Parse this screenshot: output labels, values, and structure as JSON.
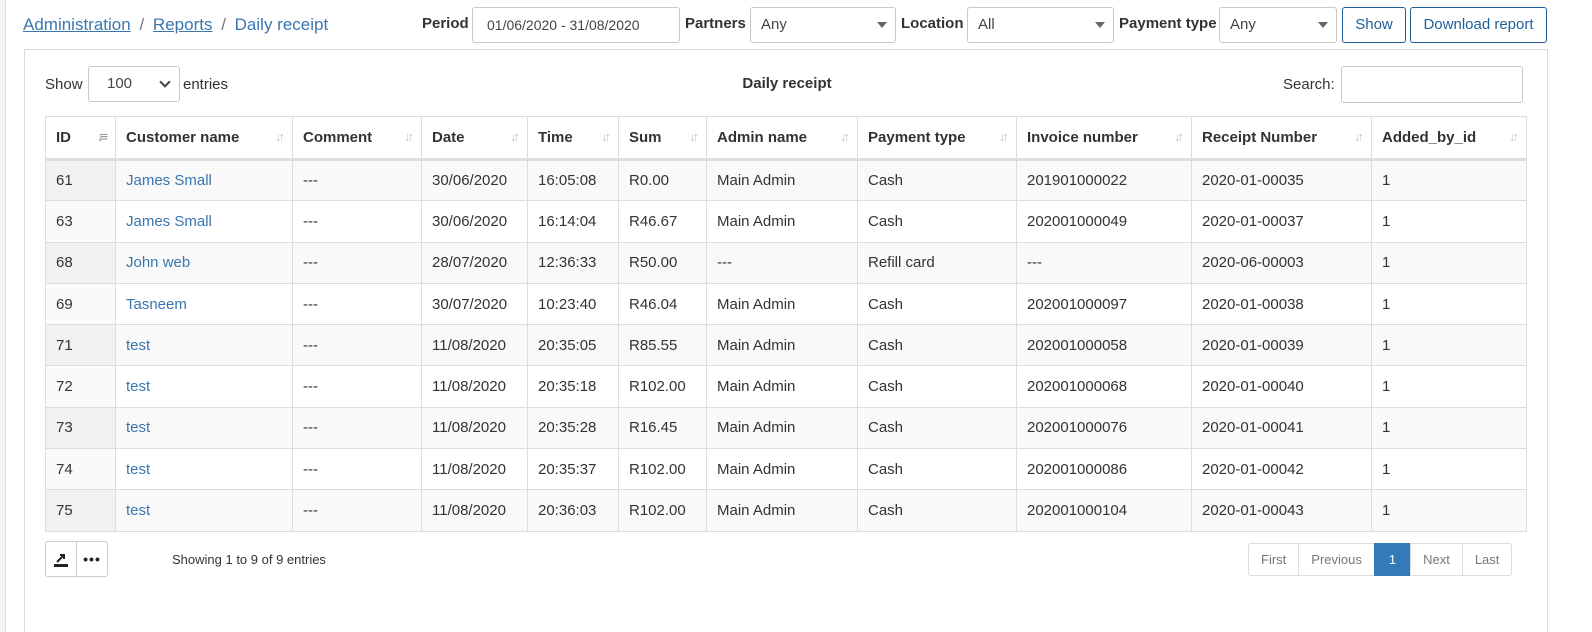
{
  "breadcrumb": {
    "items": [
      "Administration",
      "Reports"
    ],
    "current": "Daily receipt",
    "separator": "/"
  },
  "filters": {
    "period_label": "Period",
    "period_value": "01/06/2020 - 31/08/2020",
    "partners_label": "Partners",
    "partners_value": "Any",
    "location_label": "Location",
    "location_value": "All",
    "payment_type_label": "Payment type",
    "payment_type_value": "Any",
    "show_button": "Show",
    "download_button": "Download report"
  },
  "table_controls": {
    "show_label": "Show",
    "entries_value": "100",
    "entries_label": "entries",
    "title": "Daily receipt",
    "search_label": "Search:",
    "search_value": ""
  },
  "columns": [
    "ID",
    "Customer name",
    "Comment",
    "Date",
    "Time",
    "Sum",
    "Admin name",
    "Payment type",
    "Invoice number",
    "Receipt Number",
    "Added_by_id"
  ],
  "rows": [
    {
      "id": "61",
      "customer": "James Small",
      "comment": "---",
      "date": "30/06/2020",
      "time": "16:05:08",
      "sum": "R0.00",
      "admin": "Main Admin",
      "payment": "Cash",
      "invoice": "201901000022",
      "receipt": "2020-01-00035",
      "added_by": "1"
    },
    {
      "id": "63",
      "customer": "James Small",
      "comment": "---",
      "date": "30/06/2020",
      "time": "16:14:04",
      "sum": "R46.67",
      "admin": "Main Admin",
      "payment": "Cash",
      "invoice": "202001000049",
      "receipt": "2020-01-00037",
      "added_by": "1"
    },
    {
      "id": "68",
      "customer": "John web",
      "comment": "---",
      "date": "28/07/2020",
      "time": "12:36:33",
      "sum": "R50.00",
      "admin": "---",
      "payment": "Refill card",
      "invoice": "---",
      "receipt": "2020-06-00003",
      "added_by": "1"
    },
    {
      "id": "69",
      "customer": "Tasneem",
      "comment": "---",
      "date": "30/07/2020",
      "time": "10:23:40",
      "sum": "R46.04",
      "admin": "Main Admin",
      "payment": "Cash",
      "invoice": "202001000097",
      "receipt": "2020-01-00038",
      "added_by": "1"
    },
    {
      "id": "71",
      "customer": "test",
      "comment": "---",
      "date": "11/08/2020",
      "time": "20:35:05",
      "sum": "R85.55",
      "admin": "Main Admin",
      "payment": "Cash",
      "invoice": "202001000058",
      "receipt": "2020-01-00039",
      "added_by": "1"
    },
    {
      "id": "72",
      "customer": "test",
      "comment": "---",
      "date": "11/08/2020",
      "time": "20:35:18",
      "sum": "R102.00",
      "admin": "Main Admin",
      "payment": "Cash",
      "invoice": "202001000068",
      "receipt": "2020-01-00040",
      "added_by": "1"
    },
    {
      "id": "73",
      "customer": "test",
      "comment": "---",
      "date": "11/08/2020",
      "time": "20:35:28",
      "sum": "R16.45",
      "admin": "Main Admin",
      "payment": "Cash",
      "invoice": "202001000076",
      "receipt": "2020-01-00041",
      "added_by": "1"
    },
    {
      "id": "74",
      "customer": "test",
      "comment": "---",
      "date": "11/08/2020",
      "time": "20:35:37",
      "sum": "R102.00",
      "admin": "Main Admin",
      "payment": "Cash",
      "invoice": "202001000086",
      "receipt": "2020-01-00042",
      "added_by": "1"
    },
    {
      "id": "75",
      "customer": "test",
      "comment": "---",
      "date": "11/08/2020",
      "time": "20:36:03",
      "sum": "R102.00",
      "admin": "Main Admin",
      "payment": "Cash",
      "invoice": "202001000104",
      "receipt": "2020-01-00043",
      "added_by": "1"
    }
  ],
  "footer": {
    "export_icon": "export-icon",
    "more_icon": "more-icon",
    "more_glyph": "•••",
    "showing_text": "Showing 1 to 9 of 9 entries",
    "pagination": [
      "First",
      "Previous",
      "1",
      "Next",
      "Last"
    ],
    "active_page": "1"
  },
  "colors": {
    "link": "#3a76b0",
    "accent": "#337ab7",
    "button_border": "#1f5f99"
  }
}
